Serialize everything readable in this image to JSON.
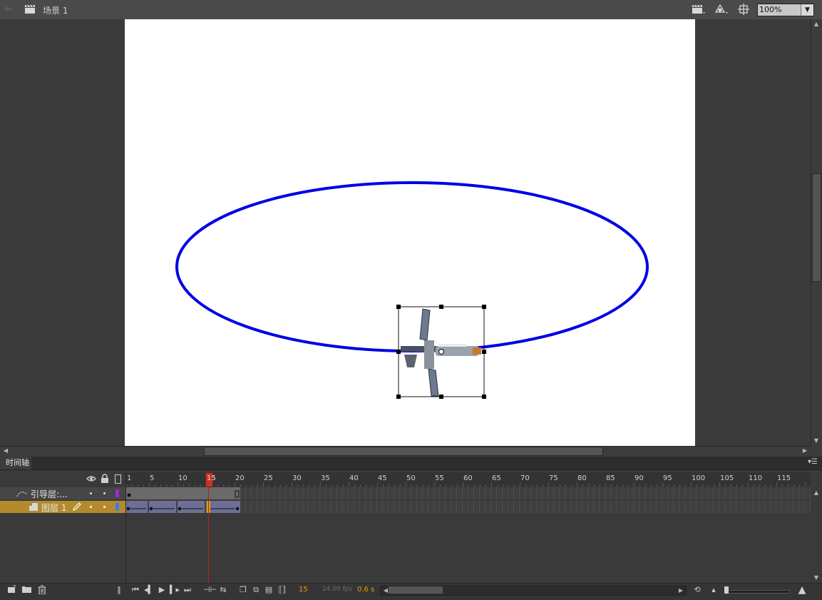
{
  "topbar": {
    "scene_label": "场景 1",
    "zoom": "100%",
    "icons": [
      "back-arrow-icon",
      "clapperboard-icon",
      "edit-scene-icon",
      "edit-symbol-icon",
      "center-stage-icon"
    ]
  },
  "stage": {
    "background": "#ffffff",
    "guide_path_color": "#0000e6",
    "selected_object": "satellite"
  },
  "timeline": {
    "tab_label": "时间轴",
    "menu_icon": "panel-menu-icon",
    "header_icons": [
      "eye-icon",
      "lock-icon",
      "outline-icon"
    ],
    "frame_ruler": [
      "1",
      "5",
      "10",
      "15",
      "20",
      "25",
      "30",
      "35",
      "40",
      "45",
      "50",
      "55",
      "60",
      "65",
      "70",
      "75",
      "80",
      "85",
      "90",
      "95",
      "100",
      "105",
      "110",
      "115"
    ],
    "current_frame_marker": "15",
    "layers": [
      {
        "name": "引导层:...",
        "icon": "guide-layer-icon",
        "color": "#9b2fc9",
        "selected": false
      },
      {
        "name": "图层 1",
        "icon": "layer-icon",
        "color": "#3a7de8",
        "selected": true
      }
    ],
    "playback": {
      "current_frame": "15",
      "frame_rate": "24.00 fps",
      "elapsed_time": "0.6 s"
    }
  },
  "colors": {
    "panel_bg": "#3b3b3b",
    "selected_layer": "#b38b2d",
    "tween_span": "#6d6f94",
    "playhead": "#c0352d"
  }
}
